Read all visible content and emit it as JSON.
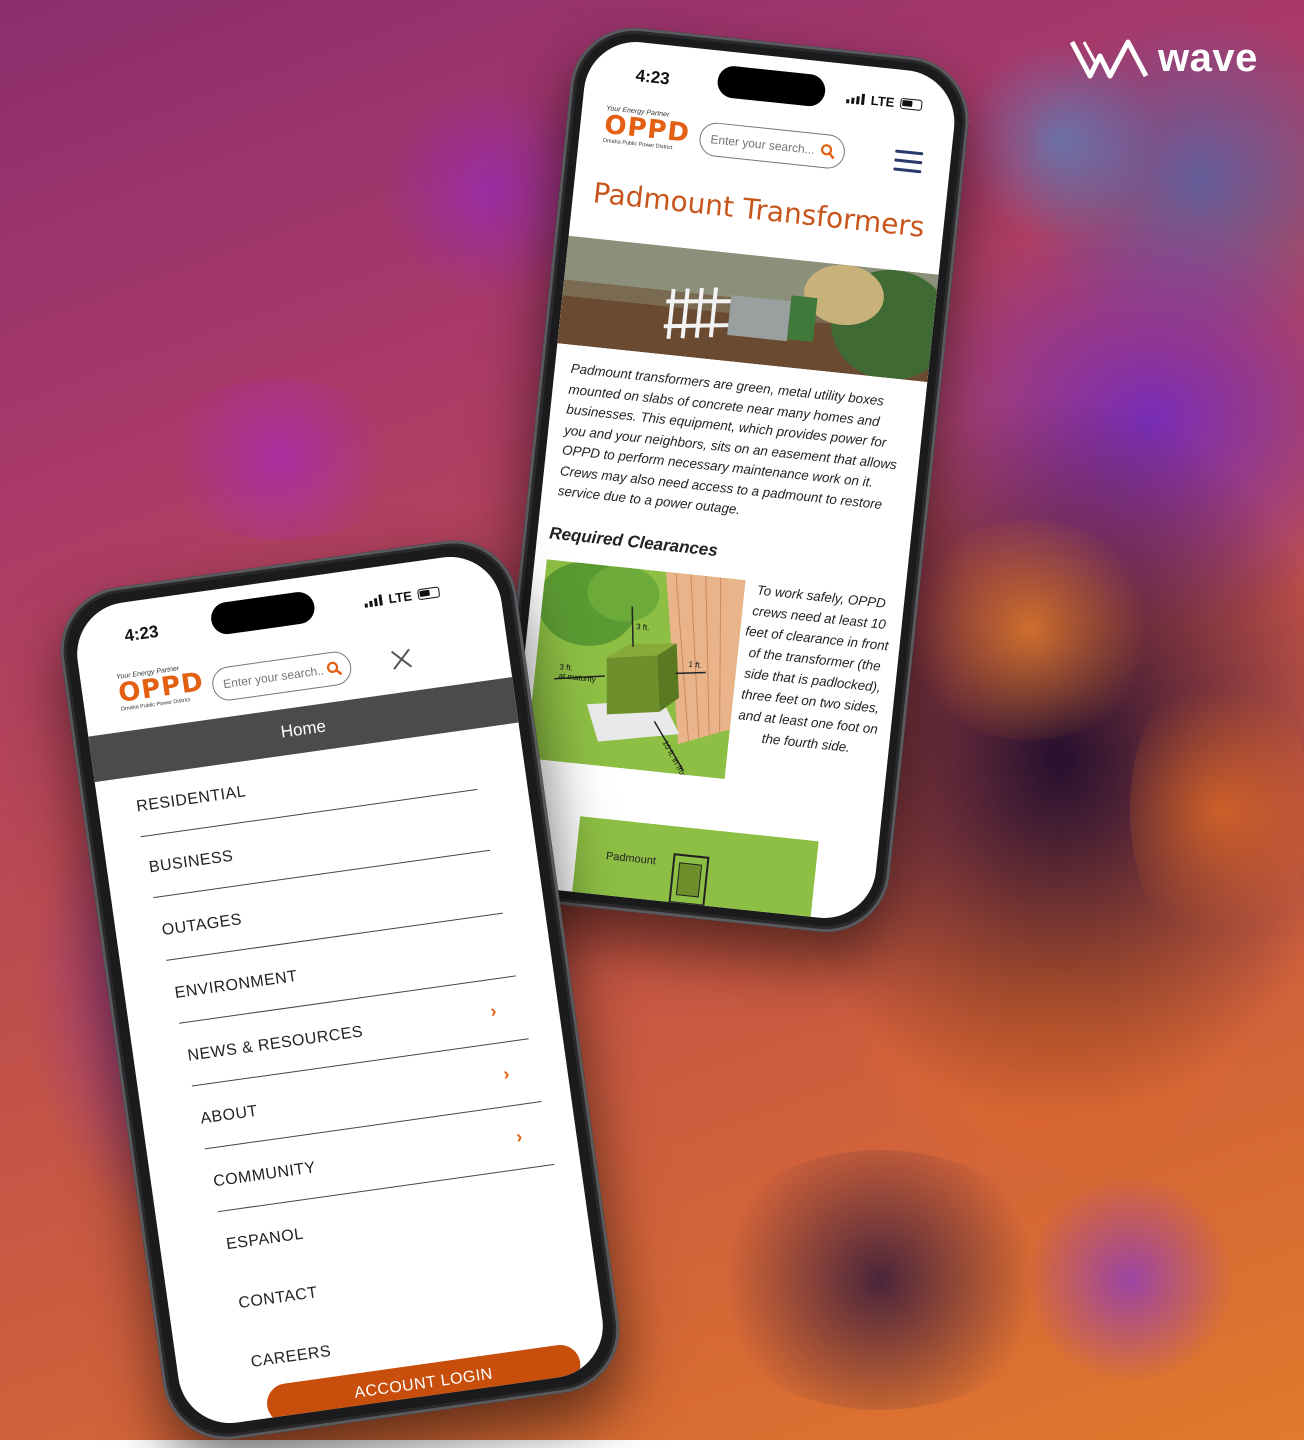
{
  "brand": {
    "name": "wave"
  },
  "status": {
    "time": "4:23",
    "network": "LTE"
  },
  "site": {
    "logo_tagline": "Your Energy Partner",
    "logo_main": "OPPD",
    "logo_subtitle": "Omaha Public Power District",
    "search_placeholder": "Enter your search..."
  },
  "menu_phone": {
    "home_label": "Home",
    "items": [
      {
        "label": "RESIDENTIAL"
      },
      {
        "label": "BUSINESS"
      },
      {
        "label": "OUTAGES"
      },
      {
        "label": "ENVIRONMENT"
      },
      {
        "label": "NEWS & RESOURCES",
        "chevron": "›"
      },
      {
        "label": "ABOUT",
        "chevron": "›"
      },
      {
        "label": "COMMUNITY",
        "chevron": "›"
      },
      {
        "label": "ESPANOL"
      },
      {
        "label": "CONTACT"
      },
      {
        "label": "CAREERS"
      }
    ],
    "login_label": "ACCOUNT LOGIN"
  },
  "article_phone": {
    "title": "Padmount Transformers",
    "intro": "Padmount transformers are green, metal utility boxes mounted on slabs of concrete near many homes and businesses. This equipment, which provides power for you and your neighbors, sits on an easement that allows OPPD to perform necessary maintenance work on it. Crews may also need access to a padmount to restore service due to a power outage.",
    "section_heading": "Required Clearances",
    "clearance_text": "To work safely, OPPD crews need at least 10 feet of clearance in front of the transformer (the side that is padlocked), three feet on two sides, and at least one foot on the fourth side.",
    "diagram_labels": {
      "top": "3 ft.",
      "right": "1 ft.",
      "left_line1": "3 ft.",
      "left_line2": "at maturity",
      "front": "10 ft. in front"
    },
    "diagram2_label": "Padmount"
  },
  "colors": {
    "accent": "#e35f12",
    "login": "#c84e0c",
    "menu_bar": "#4b4b4b",
    "title": "#c8551c"
  }
}
